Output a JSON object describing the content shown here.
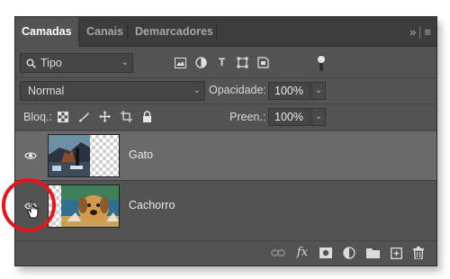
{
  "tabs": [
    {
      "label": "Camadas",
      "active": true
    },
    {
      "label": "Canais",
      "active": false
    },
    {
      "label": "Demarcadores",
      "active": false
    }
  ],
  "panel_menu": {
    "collapse_icon": "double-chevron-right-icon",
    "menu_icon": "hamburger-menu-icon"
  },
  "filter": {
    "type_label": "Tipo",
    "search_icon": "search-icon",
    "filter_icons": [
      "pixel-layer-filter-icon",
      "adjustment-layer-filter-icon",
      "type-layer-filter-icon",
      "shape-layer-filter-icon",
      "smart-object-filter-icon"
    ],
    "toggle_icon": "filter-toggle-icon"
  },
  "blend": {
    "mode": "Normal",
    "opacity_label": "Opacidade:",
    "opacity_value": "100%"
  },
  "lock": {
    "label": "Bloq.:",
    "icons": [
      "lock-transparent-pixels-icon",
      "lock-image-pixels-icon",
      "lock-position-icon",
      "lock-artboard-icon",
      "lock-all-icon"
    ],
    "fill_label": "Preen.:",
    "fill_value": "100%"
  },
  "layers": [
    {
      "name": "Gato",
      "selected": true,
      "visible": true
    },
    {
      "name": "Cachorro",
      "selected": false,
      "visible": true
    }
  ],
  "bottom_icons": [
    "link-layers-icon",
    "fx-icon",
    "add-mask-icon",
    "adjustment-layer-icon",
    "new-group-icon",
    "new-layer-icon",
    "trash-icon"
  ],
  "colors": {
    "panel": "#535353",
    "tabbar": "#3c3c3c",
    "selected_layer": "#6a6a6a",
    "highlight_circle": "#e8141c"
  }
}
